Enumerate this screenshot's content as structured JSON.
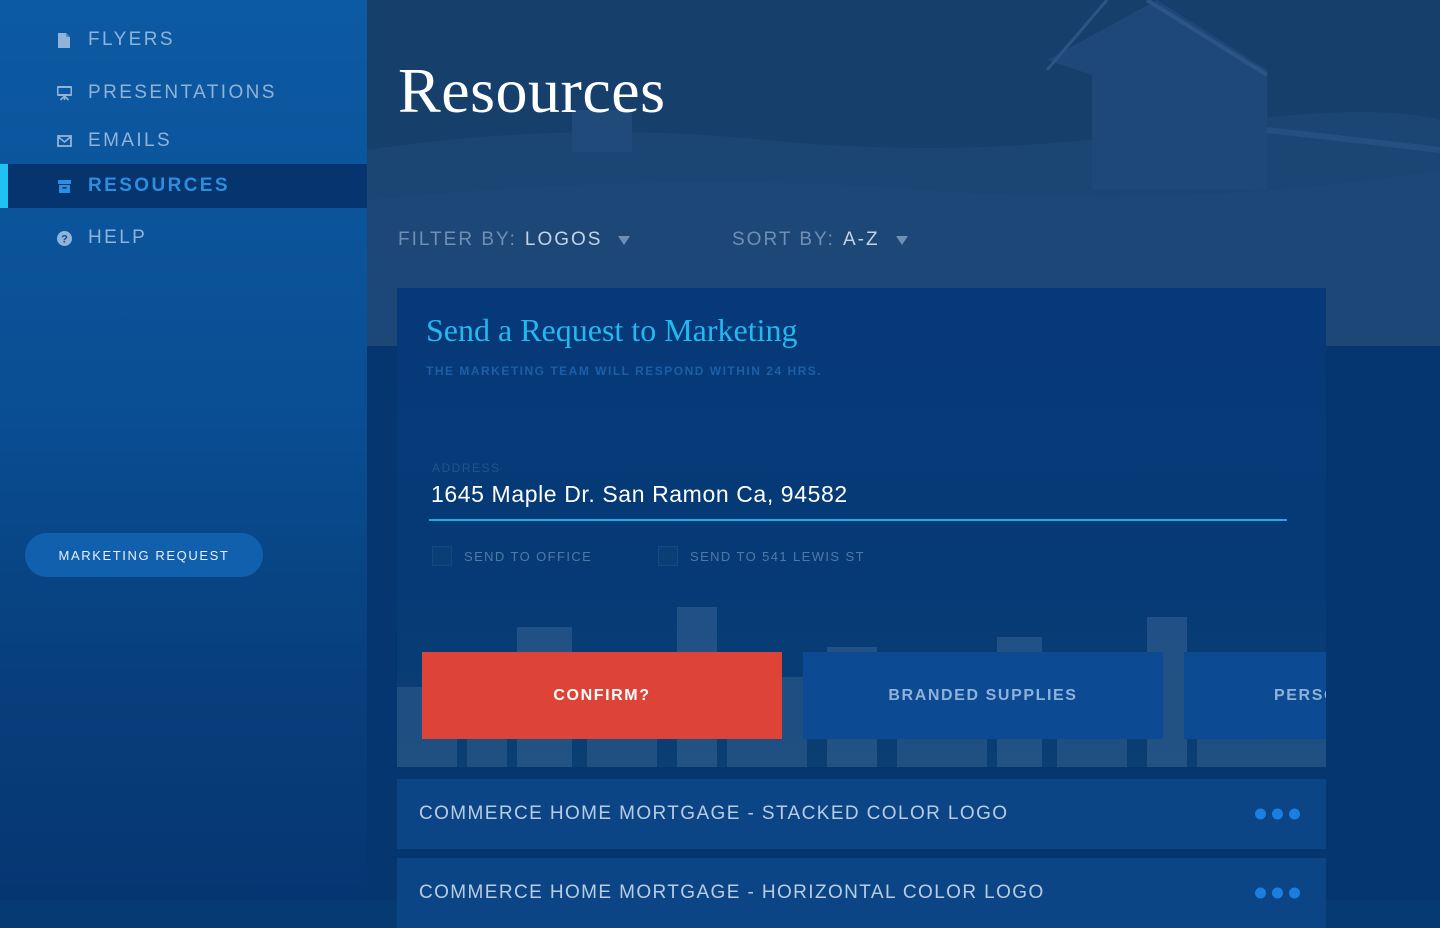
{
  "sidebar": {
    "items": [
      {
        "label": "FLYERS",
        "icon": "document-icon",
        "active": false
      },
      {
        "label": "PRESENTATIONS",
        "icon": "presentation-board-icon",
        "active": false
      },
      {
        "label": "EMAILS",
        "icon": "envelope-icon",
        "active": false
      },
      {
        "label": "RESOURCES",
        "icon": "archive-box-icon",
        "active": true
      },
      {
        "label": "HELP",
        "icon": "question-circle-icon",
        "active": false
      }
    ],
    "marketing_request_label": "MARKETING REQUEST"
  },
  "page": {
    "title": "Resources"
  },
  "filters": {
    "filter_key": "FILTER BY:",
    "filter_value": "LOGOS",
    "sort_key": "SORT BY:",
    "sort_value": "A-Z"
  },
  "request_card": {
    "title": "Send a Request to Marketing",
    "subtitle": "THE MARKETING TEAM WILL RESPOND WITHIN 24 HRS.",
    "address_label": "ADDRESS",
    "address_value": "1645 Maple Dr. San Ramon Ca, 94582",
    "options": [
      {
        "label": "SEND TO OFFICE",
        "checked": false
      },
      {
        "label": "SEND TO 541 LEWIS ST",
        "checked": false
      }
    ],
    "tiles": [
      {
        "label": "CONFIRM?",
        "style": "confirm"
      },
      {
        "label": "BRANDED SUPPLIES",
        "style": "secondary"
      },
      {
        "label": "PERSO",
        "style": "secondary"
      }
    ]
  },
  "resources": [
    {
      "name": "COMMERCE HOME MORTGAGE - STACKED COLOR LOGO"
    },
    {
      "name": "COMMERCE HOME MORTGAGE - HORIZONTAL COLOR LOGO"
    }
  ],
  "colors": {
    "accent": "#1ec2f3",
    "confirm": "#dd4336",
    "card_title": "#24b8ec"
  }
}
